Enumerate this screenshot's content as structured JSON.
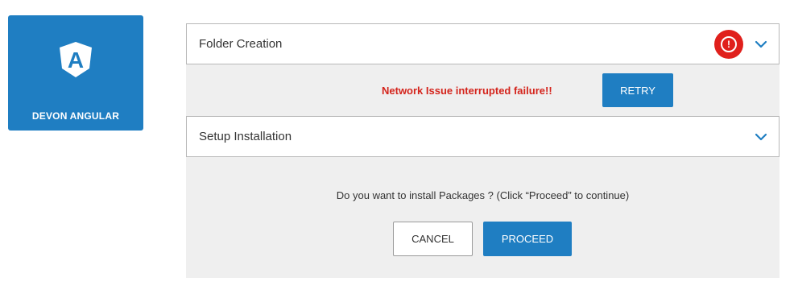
{
  "app_tile": {
    "label": "DEVON ANGULAR",
    "logo_icon": "angular-logo-icon",
    "logo_letter": "A"
  },
  "panels": {
    "folder_creation": {
      "title": "Folder Creation",
      "status_icon": "error-alert-icon",
      "status_symbol": "!"
    },
    "setup_installation": {
      "title": "Setup Installation"
    }
  },
  "error": {
    "message": "Network Issue interrupted failure!!",
    "retry_label": "RETRY"
  },
  "confirm": {
    "message": "Do you want to install Packages ? (Click “Proceed” to continue)",
    "cancel_label": "CANCEL",
    "proceed_label": "PROCEED"
  },
  "colors": {
    "brand_blue": "#1f7ec2",
    "error_red": "#e0201c",
    "panel_bg": "#efefef"
  }
}
